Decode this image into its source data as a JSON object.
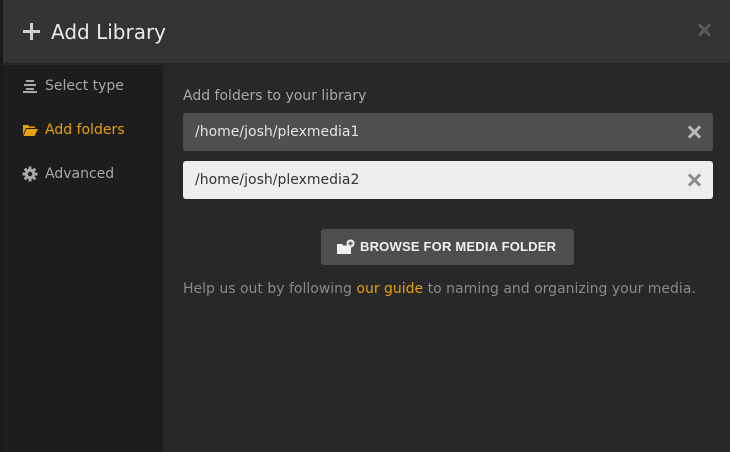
{
  "dialog": {
    "title": "Add Library",
    "icons": {
      "add": "plus-icon",
      "close": "close-icon"
    }
  },
  "sidebar": {
    "items": [
      {
        "label": "Select type",
        "icon": "list-icon",
        "active": false
      },
      {
        "label": "Add folders",
        "icon": "folder-open-icon",
        "active": true
      },
      {
        "label": "Advanced",
        "icon": "gear-icon",
        "active": false
      }
    ]
  },
  "main": {
    "section_label": "Add folders to your library",
    "folders": [
      {
        "value": "/home/josh/plexmedia1"
      },
      {
        "value": "/home/josh/plexmedia2"
      }
    ],
    "browse_button": {
      "label": "BROWSE FOR MEDIA FOLDER",
      "icon": "folder-add-icon"
    },
    "help": {
      "prefix": "Help us out by following ",
      "link": "our guide",
      "suffix": " to naming and organizing your media."
    }
  },
  "colors": {
    "accent": "#e5a00d",
    "header_bg": "#333333",
    "sidebar_bg": "#1d1d1d",
    "panel_bg": "#282828"
  }
}
